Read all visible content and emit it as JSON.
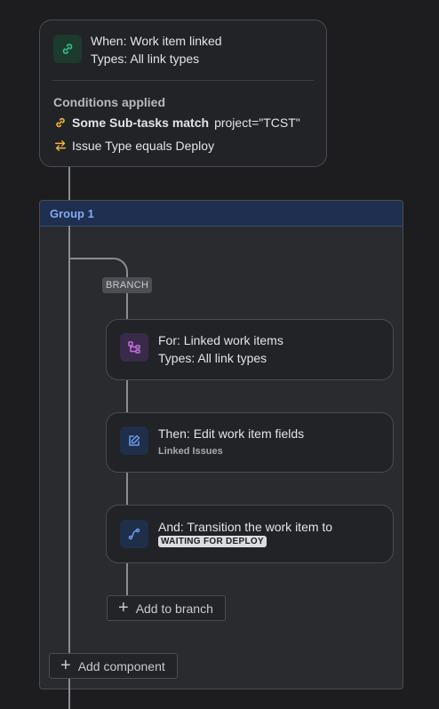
{
  "trigger": {
    "line1": "When: Work item linked",
    "line2": "Types: All link types",
    "conditions_header": "Conditions applied",
    "condition1_bold": "Some Sub-tasks match",
    "condition1_rest": "project=\"TCST\"",
    "condition2": "Issue Type equals Deploy",
    "icon": "link-icon",
    "icon_color": "#34c28a"
  },
  "group": {
    "title": "Group 1",
    "header_color": "#1e2f4f",
    "branch_label": "BRANCH",
    "branch": {
      "line1": "For: Linked work items",
      "line2": "Types: All link types",
      "icon": "branch-icon",
      "icon_color": "#c56de0"
    },
    "steps": [
      {
        "line1": "Then: Edit work item fields",
        "line2": "Linked Issues",
        "icon": "edit-icon",
        "icon_color": "#6c9bf0"
      },
      {
        "line1": "And: Transition the work item to",
        "badge": "WAITING FOR DEPLOY",
        "icon": "transition-icon",
        "icon_color": "#6c9bf0"
      }
    ],
    "add_to_branch": "Add to branch",
    "add_component": "Add component"
  },
  "colors": {
    "background": "#1d1d20",
    "card": "#222326",
    "connector": "#8a8c93",
    "condition_icon": "#f2b632"
  }
}
